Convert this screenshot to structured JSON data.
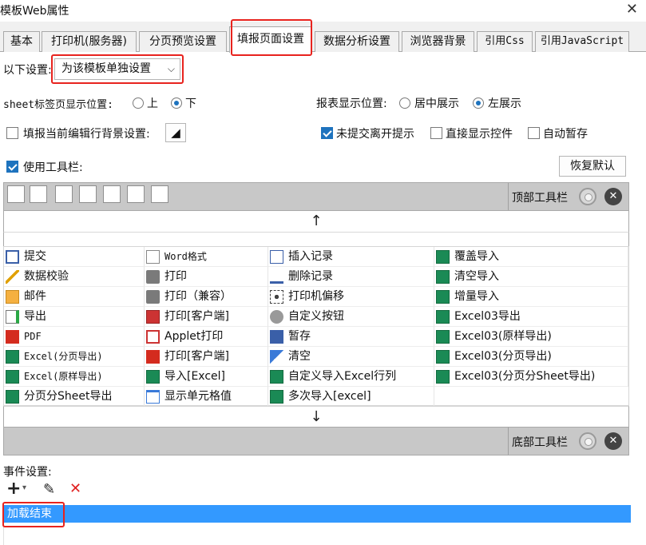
{
  "window": {
    "title": "模板Web属性",
    "close_glyph": "✕"
  },
  "tabs": [
    {
      "label": "基本"
    },
    {
      "label": "打印机(服务器)"
    },
    {
      "label": "分页预览设置"
    },
    {
      "label": "填报页面设置",
      "active": true
    },
    {
      "label": "数据分析设置"
    },
    {
      "label": "浏览器背景"
    },
    {
      "label": "引用Css"
    },
    {
      "label": "引用JavaScript"
    }
  ],
  "settings": {
    "scope_label": "以下设置:",
    "scope_value": "为该模板单独设置",
    "sheet_pos_label": "sheet标签页显示位置:",
    "sheet_pos_options": [
      "上",
      "下"
    ],
    "sheet_pos_selected": "下",
    "report_pos_label": "报表显示位置:",
    "report_pos_options": [
      "居中展示",
      "左展示"
    ],
    "report_pos_selected": "左展示",
    "bg_setting_label": "填报当前编辑行背景设置:",
    "bg_setting_checked": false,
    "unsubmitted_label": "未提交离开提示",
    "unsubmitted_checked": true,
    "direct_display_label": "直接显示控件",
    "direct_display_checked": false,
    "auto_save_label": "自动暂存",
    "auto_save_checked": false,
    "use_toolbar_label": "使用工具栏:",
    "use_toolbar_checked": true,
    "restore_default_label": "恢复默认"
  },
  "toolbar": {
    "top_label": "顶部工具栏",
    "bottom_label": "底部工具栏",
    "up_arrow": "↑",
    "down_arrow": "↓",
    "top_icons": [
      "save-icon",
      "check-icon",
      "print-icon",
      "export-icon",
      "mail-icon",
      "insert-icon",
      "cell-icon"
    ]
  },
  "buttons": {
    "col1": [
      {
        "label": "提交",
        "icon": "save"
      },
      {
        "label": "数据校验",
        "icon": "check"
      },
      {
        "label": "邮件",
        "icon": "mail"
      },
      {
        "label": "导出",
        "icon": "export"
      },
      {
        "label": "PDF",
        "icon": "pdf"
      },
      {
        "label": "Excel(分页导出)",
        "icon": "xls"
      },
      {
        "label": "Excel(原样导出)",
        "icon": "xls"
      },
      {
        "label": "分页分Sheet导出",
        "icon": "xls"
      }
    ],
    "col2": [
      {
        "label": "Word格式",
        "icon": "word"
      },
      {
        "label": "打印",
        "icon": "print"
      },
      {
        "label": "打印（兼容）",
        "icon": "print"
      },
      {
        "label": "打印[客户端]",
        "icon": "pdfp"
      },
      {
        "label": "Applet打印",
        "icon": "applet"
      },
      {
        "label": "打印[客户端]",
        "icon": "pdfp"
      },
      {
        "label": "导入[Excel]",
        "icon": "xls"
      },
      {
        "label": "显示单元格值",
        "icon": "cell"
      }
    ],
    "col3": [
      {
        "label": "插入记录",
        "icon": "insert"
      },
      {
        "label": "删除记录",
        "icon": "delete"
      },
      {
        "label": "打印机偏移",
        "icon": "move"
      },
      {
        "label": "自定义按钮",
        "icon": "gear"
      },
      {
        "label": "暂存",
        "icon": "store"
      },
      {
        "label": "清空",
        "icon": "clear"
      },
      {
        "label": "自定义导入Excel行列",
        "icon": "xls"
      },
      {
        "label": "多次导入[excel]",
        "icon": "xls"
      }
    ],
    "col4": [
      {
        "label": "覆盖导入",
        "icon": "xls"
      },
      {
        "label": "清空导入",
        "icon": "xls"
      },
      {
        "label": "增量导入",
        "icon": "xls"
      },
      {
        "label": "Excel03导出",
        "icon": "xls"
      },
      {
        "label": "Excel03(原样导出)",
        "icon": "xls"
      },
      {
        "label": "Excel03(分页导出)",
        "icon": "xls"
      },
      {
        "label": "Excel03(分页分Sheet导出)",
        "icon": "xls"
      }
    ]
  },
  "events": {
    "label": "事件设置:",
    "add_glyph": "+",
    "dropdown_glyph": "▾",
    "edit_glyph": "✎",
    "delete_glyph": "✕",
    "items": [
      "加载结束"
    ]
  },
  "colors": {
    "accent": "#1e73be",
    "highlight": "#e8231e",
    "selection": "#3399ff"
  }
}
